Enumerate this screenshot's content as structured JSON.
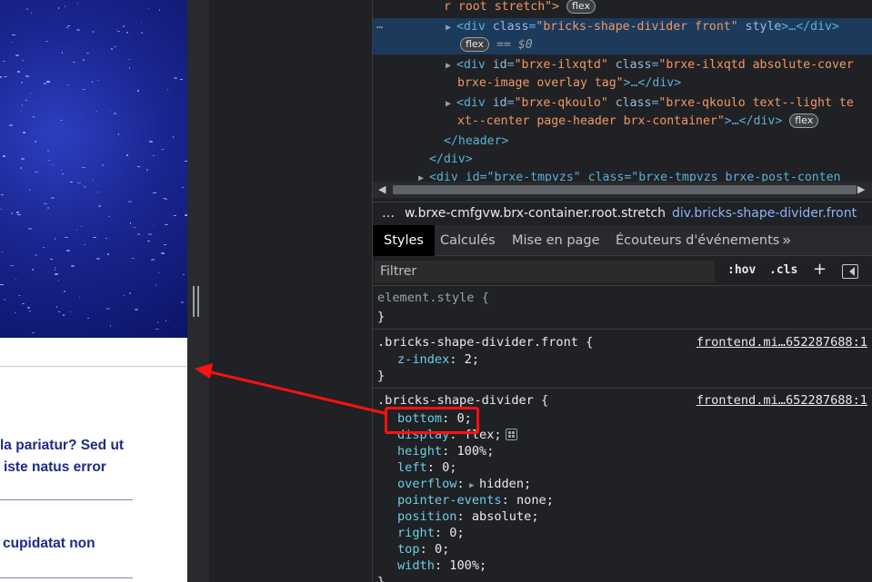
{
  "webpage": {
    "text_line_1": "la pariatur? Sed ut",
    "text_line_2": "iste natus error",
    "text_line_3": "cupidatat non"
  },
  "elements_panel": {
    "line0_text": "r root stretch\">",
    "line0_badge": "flex",
    "selected_tag_open": "<div",
    "selected_class_attr": "class",
    "selected_class_val": "\"bricks-shape-divider front\"",
    "selected_style_attr": "style",
    "selected_tail": ">…</div>",
    "selected_badge": "flex",
    "selected_eq": "== $0",
    "ellipsis": "…",
    "line2_tag": "<div",
    "line2_id_attr": "id",
    "line2_id_val": "\"brxe-ilxqtd\"",
    "line2_class_attr": "class",
    "line2_class_val": "\"brxe-ilxqtd absolute-cover",
    "line2b_class_val": "brxe-image overlay tag\"",
    "line2b_tail": ">…</div>",
    "line3_tag": "<div",
    "line3_id_attr": "id",
    "line3_id_val": "\"brxe-qkoulo\"",
    "line3_class_attr": "class",
    "line3_class_val": "\"brxe-qkoulo text--light te",
    "line3b_class_val": "xt--center page-header brx-container\"",
    "line3b_tail": ">…</div>",
    "line3b_badge": "flex",
    "close_header": "</header>",
    "close_div": "</div>",
    "line_cut": "<div id=\"brxe-tmpvzs\" class=\"brxe-tmpvzs brxe-post-conten"
  },
  "breadcrumbs": {
    "ellipsis": "…",
    "crumb1": "w.brxe-cmfgvw.brx-container.root.stretch",
    "crumb2": "div.bricks-shape-divider.front"
  },
  "tabs": {
    "styles": "Styles",
    "computed": "Calculés",
    "layout": "Mise en page",
    "listeners": "Écouteurs d'événements",
    "more": "»"
  },
  "filter": {
    "placeholder": "Filtrer",
    "hov": ":hov",
    "cls": ".cls",
    "plus": "+"
  },
  "styles": {
    "element_style": "element.style {",
    "close_brace": "}",
    "rule1_selector": ".bricks-shape-divider.front {",
    "rule1_source": "frontend.mi…652287688:1",
    "rule1_props": [
      {
        "name": "z-index",
        "value": "2;"
      }
    ],
    "rule2_selector": ".bricks-shape-divider {",
    "rule2_source": "frontend.mi…652287688:1",
    "rule2_props": [
      {
        "name": "bottom",
        "value": "0;"
      },
      {
        "name": "display",
        "value": "flex;"
      },
      {
        "name": "height",
        "value": "100%;"
      },
      {
        "name": "left",
        "value": "0;"
      },
      {
        "name": "overflow",
        "value": "hidden;"
      },
      {
        "name": "pointer-events",
        "value": "none;"
      },
      {
        "name": "position",
        "value": "absolute;"
      },
      {
        "name": "right",
        "value": "0;"
      },
      {
        "name": "top",
        "value": "0;"
      },
      {
        "name": "width",
        "value": "100%;"
      }
    ]
  },
  "colors": {
    "highlight": "#ff1111",
    "selected_row": "#1b3a5c",
    "hero_blue": "#1a2590"
  }
}
